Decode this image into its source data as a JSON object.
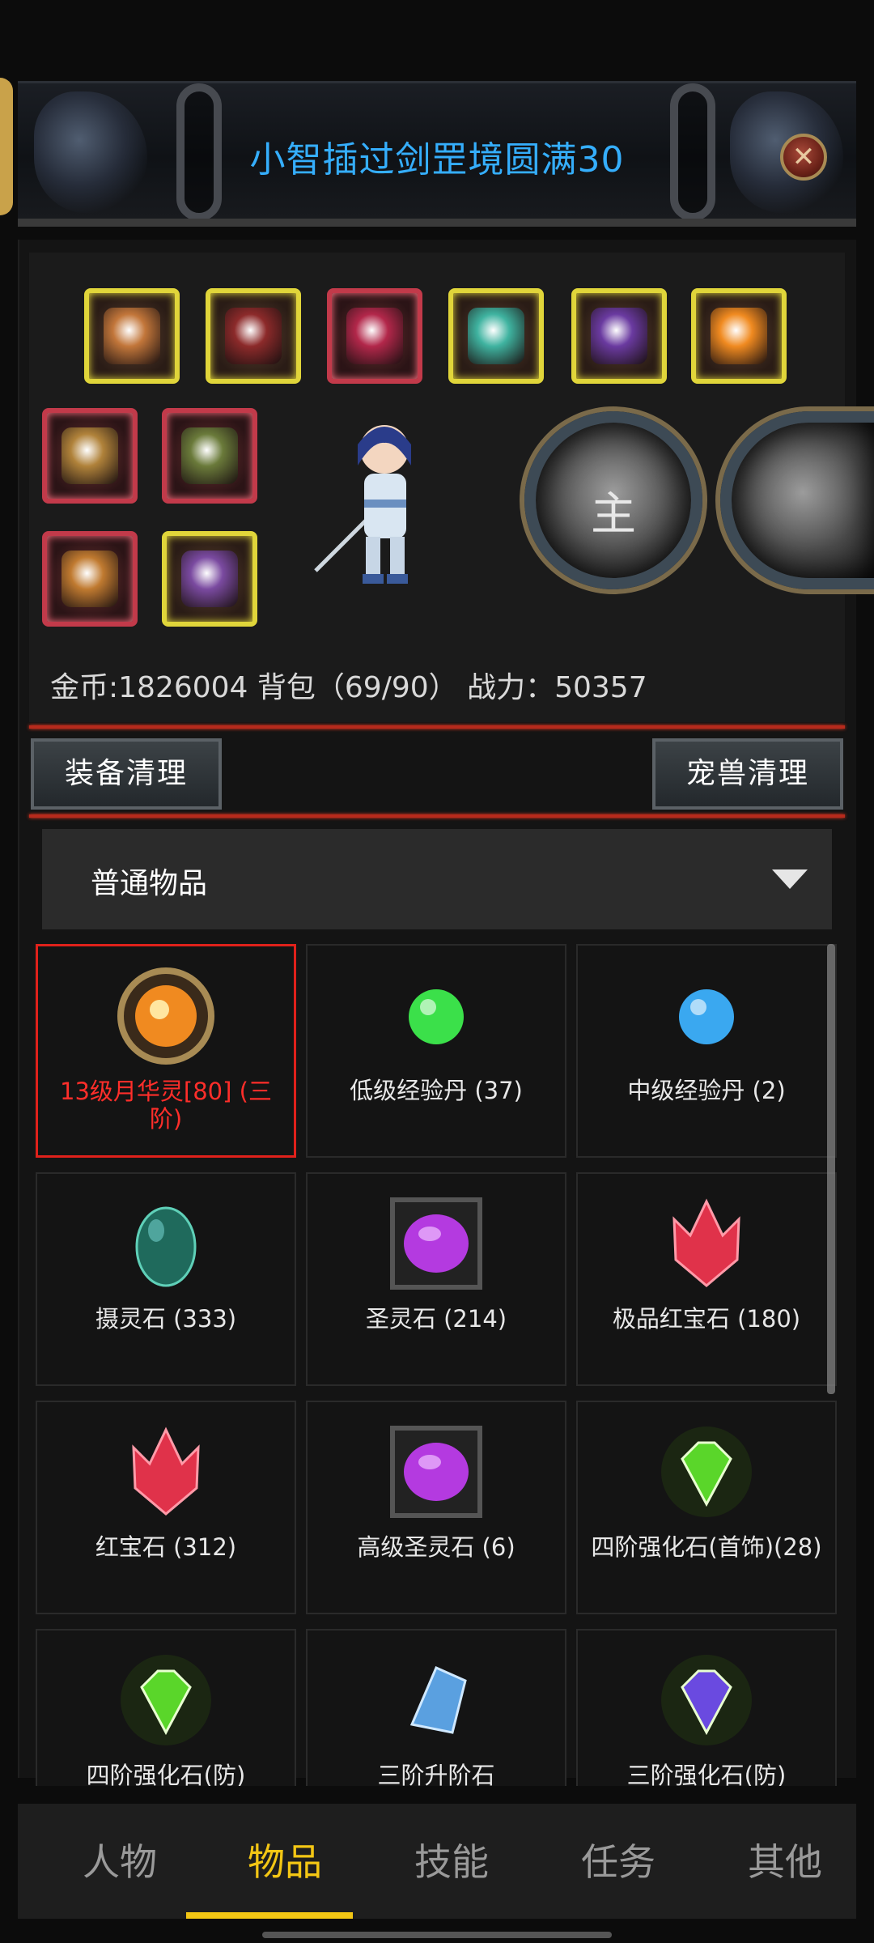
{
  "window": {
    "title": "小智插过剑罡境圆满30"
  },
  "equipment": {
    "slots": [
      {
        "name": "equip-helmet",
        "frame": "gold",
        "color": "#c2763a"
      },
      {
        "name": "equip-armor",
        "frame": "gold",
        "color": "#8c2a2a"
      },
      {
        "name": "equip-shoulder",
        "frame": "red",
        "color": "#b2274a"
      },
      {
        "name": "equip-bracer",
        "frame": "gold",
        "color": "#3fb3a0"
      },
      {
        "name": "equip-boots",
        "frame": "gold",
        "color": "#6a3aa0"
      },
      {
        "name": "equip-orb",
        "frame": "gold",
        "color": "#f08a20"
      },
      {
        "name": "equip-sword-1",
        "frame": "red",
        "color": "#b0823a"
      },
      {
        "name": "equip-sword-2",
        "frame": "red",
        "color": "#6a7a3a"
      },
      {
        "name": "equip-belt",
        "frame": "red",
        "color": "#c07a30"
      },
      {
        "name": "equip-amulet",
        "frame": "gold",
        "color": "#7a4aa0"
      }
    ],
    "pets": [
      {
        "label": "主"
      },
      {
        "label": ""
      }
    ]
  },
  "stats": {
    "text": "金币:1826004 背包（69/90） 战力：50357"
  },
  "buttons": {
    "equip_cleanup": "装备清理",
    "pet_cleanup": "宠兽清理"
  },
  "filter": {
    "selected": "普通物品"
  },
  "items": [
    {
      "name": "13级月华灵[80] (三阶)",
      "icon": "orb-icon",
      "color": "#f08a20",
      "selected": true
    },
    {
      "name": "低级经验丹 (37)",
      "icon": "green-pill-icon",
      "color": "#3be04a",
      "selected": false
    },
    {
      "name": "中级经验丹 (2)",
      "icon": "blue-pill-icon",
      "color": "#3aa8f0",
      "selected": false
    },
    {
      "name": "摄灵石 (333)",
      "icon": "teal-egg-icon",
      "color": "#1f6a5c",
      "selected": false
    },
    {
      "name": "圣灵石 (214)",
      "icon": "purple-stone-icon",
      "color": "#b43ae0",
      "selected": false
    },
    {
      "name": "极品红宝石 (180)",
      "icon": "red-crystal-icon",
      "color": "#e0324a",
      "selected": false
    },
    {
      "name": "红宝石 (312)",
      "icon": "red-crystal-icon",
      "color": "#e0324a",
      "selected": false
    },
    {
      "name": "高级圣灵石 (6)",
      "icon": "purple-stone-icon",
      "color": "#b43ae0",
      "selected": false
    },
    {
      "name": "四阶强化石(首饰)(28)",
      "icon": "green-gem-icon",
      "color": "#5ad62a",
      "selected": false
    },
    {
      "name": "四阶强化石(防)",
      "icon": "green-gem-icon",
      "color": "#5ad62a",
      "selected": false
    },
    {
      "name": "三阶升阶石",
      "icon": "blue-shard-icon",
      "color": "#5aa0e0",
      "selected": false
    },
    {
      "name": "三阶强化石(防)",
      "icon": "violet-gem-icon",
      "color": "#6a4ae0",
      "selected": false
    }
  ],
  "nav": {
    "tabs": [
      "人物",
      "物品",
      "技能",
      "任务",
      "其他"
    ],
    "active_index": 1
  },
  "colors": {
    "title": "#35aefc",
    "accent": "#f3c614",
    "selected_border": "#e0211b",
    "divider": "#b72a1c"
  }
}
